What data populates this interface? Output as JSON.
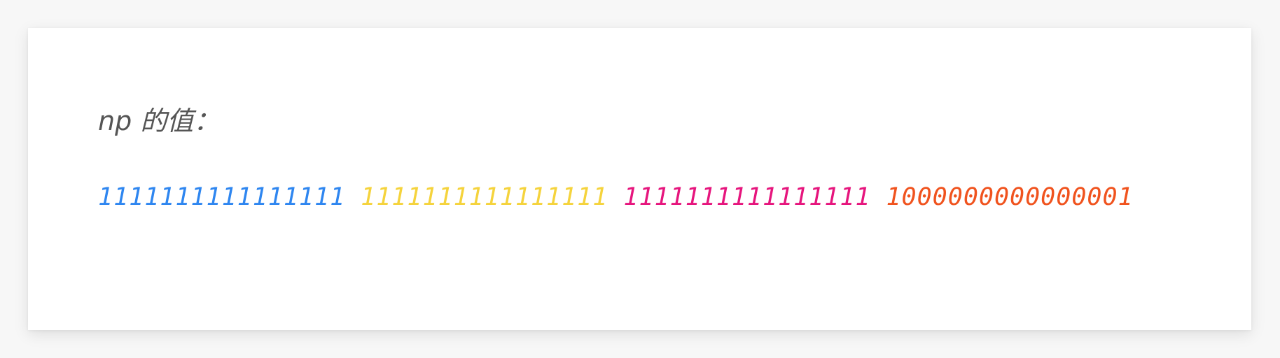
{
  "label": "np 的值：",
  "groups": [
    {
      "text": "1111111111111111",
      "color": "#2e86f0"
    },
    {
      "text": "1111111111111111",
      "color": "#f5d33c"
    },
    {
      "text": "1111111111111111",
      "color": "#e6157d"
    },
    {
      "text": "1000000000000001",
      "color": "#f0531e"
    }
  ]
}
